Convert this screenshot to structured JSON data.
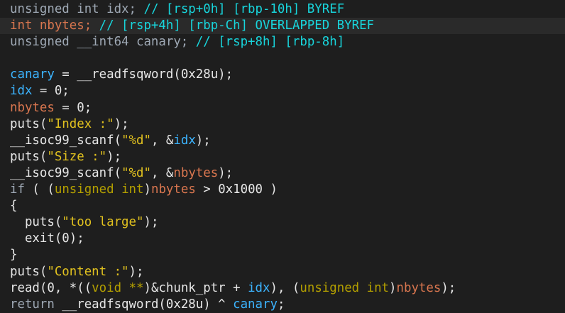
{
  "window": {
    "title": "",
    "colors": {
      "background": "#1e1e1e",
      "highlight_line": "#2a2a2a",
      "default_text": "#e6e6e6",
      "type_keyword": "#9ea8b4",
      "comment": "#18d5dc",
      "local_var": "#3cb4ff",
      "overlapped_var": "#d9764f",
      "string_literal": "#e2c21f",
      "cast_keyword": "#b4a000"
    }
  },
  "code": {
    "lines": [
      {
        "highlight": false,
        "tokens": [
          {
            "t": "unsigned int idx; ",
            "c": "type"
          },
          {
            "t": "// [rsp+0h] [rbp-10h] BYREF",
            "c": "comment"
          }
        ]
      },
      {
        "highlight": true,
        "tokens": [
          {
            "t": "int nbytes; ",
            "c": "nb"
          },
          {
            "t": "// [rsp+4h] [rbp-Ch] OVERLAPPED BYREF",
            "c": "comment"
          }
        ]
      },
      {
        "highlight": false,
        "tokens": [
          {
            "t": "unsigned __int64 canary; ",
            "c": "type"
          },
          {
            "t": "// [rsp+8h] [rbp-8h]",
            "c": "comment"
          }
        ]
      },
      {
        "highlight": false,
        "tokens": [
          {
            "t": "",
            "c": "code"
          }
        ]
      },
      {
        "highlight": false,
        "tokens": [
          {
            "t": "canary",
            "c": "var"
          },
          {
            "t": " = __readfsqword(0x28u);",
            "c": "code"
          }
        ]
      },
      {
        "highlight": false,
        "tokens": [
          {
            "t": "idx",
            "c": "var"
          },
          {
            "t": " = 0;",
            "c": "code"
          }
        ]
      },
      {
        "highlight": false,
        "tokens": [
          {
            "t": "nbytes",
            "c": "nb"
          },
          {
            "t": " = 0;",
            "c": "code"
          }
        ]
      },
      {
        "highlight": false,
        "tokens": [
          {
            "t": "puts(",
            "c": "code"
          },
          {
            "t": "\"Index :\"",
            "c": "str"
          },
          {
            "t": ");",
            "c": "code"
          }
        ]
      },
      {
        "highlight": false,
        "tokens": [
          {
            "t": "__isoc99_scanf(",
            "c": "code"
          },
          {
            "t": "\"%d\"",
            "c": "str"
          },
          {
            "t": ", &",
            "c": "code"
          },
          {
            "t": "idx",
            "c": "var"
          },
          {
            "t": ");",
            "c": "code"
          }
        ]
      },
      {
        "highlight": false,
        "tokens": [
          {
            "t": "puts(",
            "c": "code"
          },
          {
            "t": "\"Size :\"",
            "c": "str"
          },
          {
            "t": ");",
            "c": "code"
          }
        ]
      },
      {
        "highlight": false,
        "tokens": [
          {
            "t": "__isoc99_scanf(",
            "c": "code"
          },
          {
            "t": "\"%d\"",
            "c": "str"
          },
          {
            "t": ", &",
            "c": "code"
          },
          {
            "t": "nbytes",
            "c": "nb"
          },
          {
            "t": ");",
            "c": "code"
          }
        ]
      },
      {
        "highlight": false,
        "tokens": [
          {
            "t": "if",
            "c": "type"
          },
          {
            "t": " ( (",
            "c": "code"
          },
          {
            "t": "unsigned int",
            "c": "kw"
          },
          {
            "t": ")",
            "c": "code"
          },
          {
            "t": "nbytes",
            "c": "nb"
          },
          {
            "t": " > 0x1000 )",
            "c": "code"
          }
        ]
      },
      {
        "highlight": false,
        "tokens": [
          {
            "t": "{",
            "c": "code"
          }
        ]
      },
      {
        "highlight": false,
        "tokens": [
          {
            "t": "  puts(",
            "c": "code"
          },
          {
            "t": "\"too large\"",
            "c": "str"
          },
          {
            "t": ");",
            "c": "code"
          }
        ]
      },
      {
        "highlight": false,
        "tokens": [
          {
            "t": "  exit(0);",
            "c": "code"
          }
        ]
      },
      {
        "highlight": false,
        "tokens": [
          {
            "t": "}",
            "c": "code"
          }
        ]
      },
      {
        "highlight": false,
        "tokens": [
          {
            "t": "puts(",
            "c": "code"
          },
          {
            "t": "\"Content :\"",
            "c": "str"
          },
          {
            "t": ");",
            "c": "code"
          }
        ]
      },
      {
        "highlight": false,
        "tokens": [
          {
            "t": "read(0, *((",
            "c": "code"
          },
          {
            "t": "void **",
            "c": "kw"
          },
          {
            "t": ")&chunk_ptr + ",
            "c": "code"
          },
          {
            "t": "idx",
            "c": "var"
          },
          {
            "t": "), (",
            "c": "code"
          },
          {
            "t": "unsigned int",
            "c": "kw"
          },
          {
            "t": ")",
            "c": "code"
          },
          {
            "t": "nbytes",
            "c": "nb"
          },
          {
            "t": ");",
            "c": "code"
          }
        ]
      },
      {
        "highlight": false,
        "tokens": [
          {
            "t": "return",
            "c": "type"
          },
          {
            "t": " __readfsqword(0x28u) ^ ",
            "c": "code"
          },
          {
            "t": "canary",
            "c": "var"
          },
          {
            "t": ";",
            "c": "code"
          }
        ]
      }
    ]
  }
}
